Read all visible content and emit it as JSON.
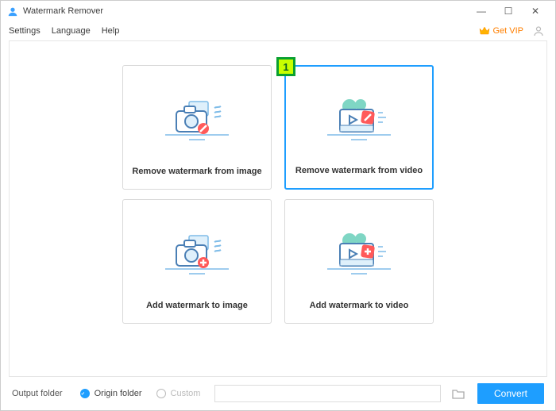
{
  "titlebar": {
    "title": "Watermark Remover"
  },
  "menu": {
    "settings": "Settings",
    "language": "Language",
    "help": "Help",
    "getvip": "Get VIP"
  },
  "cards": {
    "remove_image": "Remove watermark from image",
    "remove_video": "Remove watermark from video",
    "add_image": "Add watermark to image",
    "add_video": "Add watermark to video"
  },
  "marker": "1",
  "footer": {
    "output_label": "Output folder",
    "origin": "Origin folder",
    "custom": "Custom",
    "path": "",
    "convert": "Convert"
  }
}
